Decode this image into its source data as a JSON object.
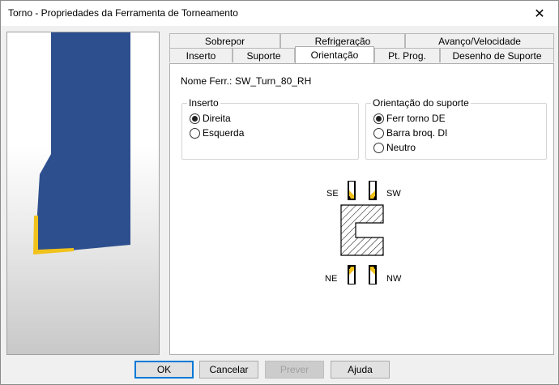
{
  "window": {
    "title": "Torno - Propriedades da Ferramenta de Torneamento",
    "close_glyph": "✕"
  },
  "tabs": {
    "row_back": [
      {
        "label": "Sobrepor"
      },
      {
        "label": "Refrigeração"
      },
      {
        "label": "Avanço/Velocidade"
      }
    ],
    "row_front": [
      {
        "label": "Inserto"
      },
      {
        "label": "Suporte"
      },
      {
        "label": "Orientação",
        "active": true
      },
      {
        "label": "Pt. Prog."
      },
      {
        "label": "Desenho de Suporte"
      }
    ]
  },
  "orientation": {
    "tool_name_label": "Nome Ferr.:",
    "tool_name_value": "SW_Turn_80_RH",
    "insert_group": {
      "title": "Inserto",
      "options": [
        {
          "label": "Direita",
          "checked": true
        },
        {
          "label": "Esquerda",
          "checked": false
        }
      ]
    },
    "holder_group": {
      "title": "Orientação do suporte",
      "options": [
        {
          "label": "Ferr torno DE",
          "checked": true
        },
        {
          "label": "Barra broq. DI",
          "checked": false
        },
        {
          "label": "Neutro",
          "checked": false
        }
      ]
    },
    "diagram_labels": {
      "se": "SE",
      "sw": "SW",
      "ne": "NE",
      "nw": "NW"
    }
  },
  "colors": {
    "tool_body": "#2e4f8e",
    "insert": "#f1c21b",
    "accent": "#0078d7"
  },
  "buttons": {
    "ok": "OK",
    "cancel": "Cancelar",
    "preview": "Prever",
    "help": "Ajuda"
  }
}
